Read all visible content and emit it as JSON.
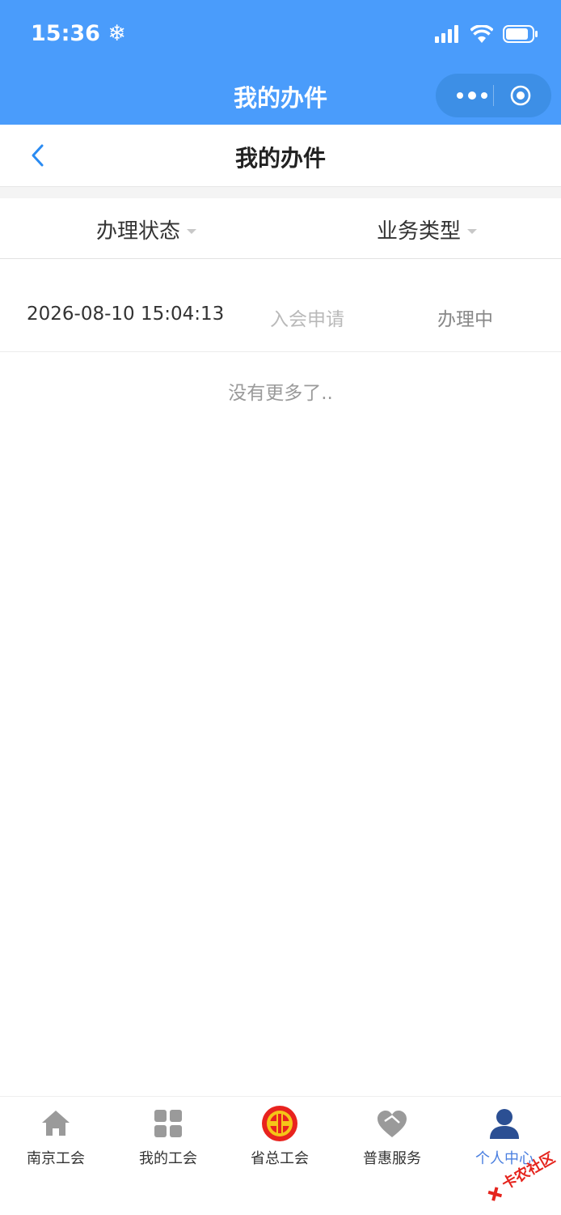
{
  "status_bar": {
    "time": "15:36"
  },
  "mini_program_title": "我的办件",
  "page": {
    "title": "我的办件"
  },
  "filters": {
    "status_label": "办理状态",
    "type_label": "业务类型"
  },
  "records": [
    {
      "time": "2026-08-10 15:04:13",
      "type": "入会申请",
      "status": "办理中"
    }
  ],
  "no_more_text": "没有更多了..",
  "tabbar": {
    "items": [
      {
        "label": "南京工会",
        "icon": "home-icon"
      },
      {
        "label": "我的工会",
        "icon": "grid-icon"
      },
      {
        "label": "省总工会",
        "icon": "union-emblem-icon"
      },
      {
        "label": "普惠服务",
        "icon": "heart-icon"
      },
      {
        "label": "个人中心",
        "icon": "person-icon",
        "active": true
      }
    ]
  },
  "watermark": "卡农社区",
  "colors": {
    "header_blue": "#4a9cfb",
    "accent_blue": "#4a7fe0"
  }
}
